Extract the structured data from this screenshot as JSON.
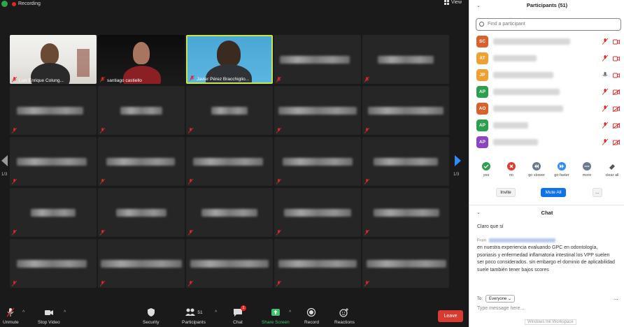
{
  "top_bar": {
    "recording_label": "Recording",
    "view_label": "View"
  },
  "gallery": {
    "tiles": [
      {
        "name": "Luis Enrique Colung..."
      },
      {
        "name": "santiago castiello"
      },
      {
        "name": "Javier Pérez Bracchiglio..."
      }
    ],
    "page_indicator": "1/3"
  },
  "toolbar": {
    "unmute": "Unmute",
    "stop_video": "Stop Video",
    "security": "Security",
    "participants": "Participants",
    "participants_count": "51",
    "chat": "Chat",
    "chat_badge": "1",
    "share_screen": "Share Screen",
    "record": "Record",
    "reactions": "Reactions",
    "leave": "Leave"
  },
  "participants_panel": {
    "title": "Participants (51)",
    "search_placeholder": "Find a participant",
    "rows": [
      {
        "initials": "SC",
        "color": "#d9622b"
      },
      {
        "initials": "AT",
        "color": "#f0a030"
      },
      {
        "initials": "JP",
        "color": "#f0a030"
      },
      {
        "initials": "AP",
        "color": "#2e9e4f"
      },
      {
        "initials": "AO",
        "color": "#d9622b"
      },
      {
        "initials": "AP",
        "color": "#2e9e4f"
      },
      {
        "initials": "AP",
        "color": "#8c44c6"
      }
    ],
    "reactions": [
      {
        "label": "yes",
        "color": "#2e9e4f",
        "icon": "check-icon"
      },
      {
        "label": "no",
        "color": "#e03c31",
        "icon": "x-icon"
      },
      {
        "label": "go slower",
        "color": "#6b7a90",
        "icon": "rewind-icon"
      },
      {
        "label": "go faster",
        "color": "#2d8cff",
        "icon": "fast-forward-icon"
      },
      {
        "label": "more",
        "color": "#6b7a90",
        "icon": "more-icon"
      },
      {
        "label": "clear all",
        "color": "#555555",
        "icon": "eraser-icon"
      }
    ],
    "invite": "Invite",
    "mute_all": "Mute All",
    "more": "..."
  },
  "chat_panel": {
    "title": "Chat",
    "previous_message": "Claro que sí",
    "from_label": "From",
    "message": "en nuestra experiencia evaluando GPC en odontología, psoriasis y enfermedad inflamatoria intestinal los VPP suelen ser poco considerados. sin embargo el dominio de aplicabilidad suele también tener bajos scores",
    "to_label": "To:",
    "to_value": "Everyone",
    "input_placeholder": "Type message here...",
    "ink_label": "Windows Ink Workspace",
    "more_dots": "..."
  }
}
